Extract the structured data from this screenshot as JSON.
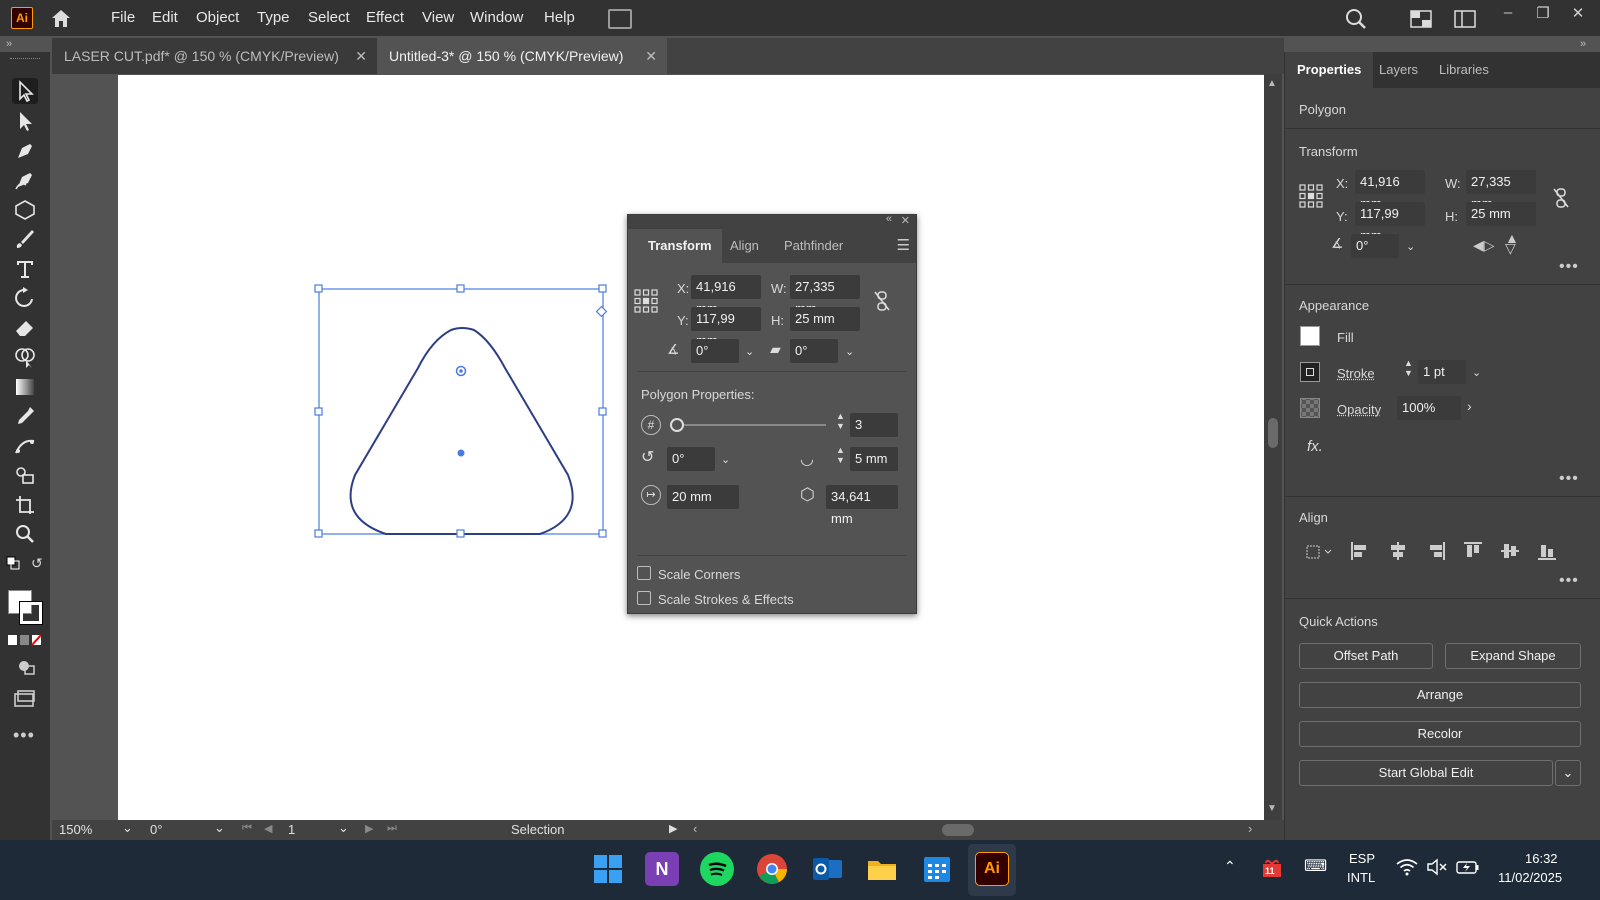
{
  "menubar": {
    "logo": "Ai",
    "items": [
      "File",
      "Edit",
      "Object",
      "Type",
      "Select",
      "Effect",
      "View",
      "Window",
      "Help"
    ]
  },
  "document_tabs": [
    {
      "label": "LASER CUT.pdf* @ 150 % (CMYK/Preview)",
      "active": false
    },
    {
      "label": "Untitled-3* @ 150 % (CMYK/Preview)",
      "active": true
    }
  ],
  "transform_panel": {
    "tabs": [
      "Transform",
      "Align",
      "Pathfinder"
    ],
    "x_label": "X:",
    "x": "41,916 mm",
    "y_label": "Y:",
    "y": "117,99 mm",
    "w_label": "W:",
    "w": "27,335 mm",
    "h_label": "H:",
    "h": "25 mm",
    "rotate": "0°",
    "shear": "0°",
    "polygon_properties_label": "Polygon Properties:",
    "sides": "3",
    "polygon_angle": "0°",
    "corner_radius": "5 mm",
    "radius": "20 mm",
    "side_length": "34,641 mm",
    "scale_corners": "Scale Corners",
    "scale_strokes": "Scale Strokes & Effects"
  },
  "properties_panel": {
    "tabs": [
      "Properties",
      "Layers",
      "Libraries"
    ],
    "object_type": "Polygon",
    "transform_title": "Transform",
    "x_label": "X:",
    "x": "41,916 mm",
    "y_label": "Y:",
    "y": "117,99 mm",
    "w_label": "W:",
    "w": "27,335 mm",
    "h_label": "H:",
    "h": "25 mm",
    "angle": "0°",
    "appearance_title": "Appearance",
    "fill_label": "Fill",
    "stroke_label": "Stroke",
    "stroke_value": "1 pt",
    "opacity_label": "Opacity",
    "opacity_value": "100%",
    "fx_label": "fx.",
    "align_title": "Align",
    "quick_actions_title": "Quick Actions",
    "offset_path": "Offset Path",
    "expand_shape": "Expand Shape",
    "arrange": "Arrange",
    "recolor": "Recolor",
    "start_global_edit": "Start Global Edit"
  },
  "statusbar": {
    "zoom": "150%",
    "rotation": "0°",
    "artboard": "1",
    "tool": "Selection"
  },
  "taskbar": {
    "lang": "ESP",
    "layout": "INTL",
    "time": "16:32",
    "date": "11/02/2025",
    "notification_badge": "11"
  },
  "colors": {
    "accent_selection": "#4a7ce0",
    "shape_stroke": "#2d3f84",
    "illustrator_orange": "#ff9a00"
  }
}
